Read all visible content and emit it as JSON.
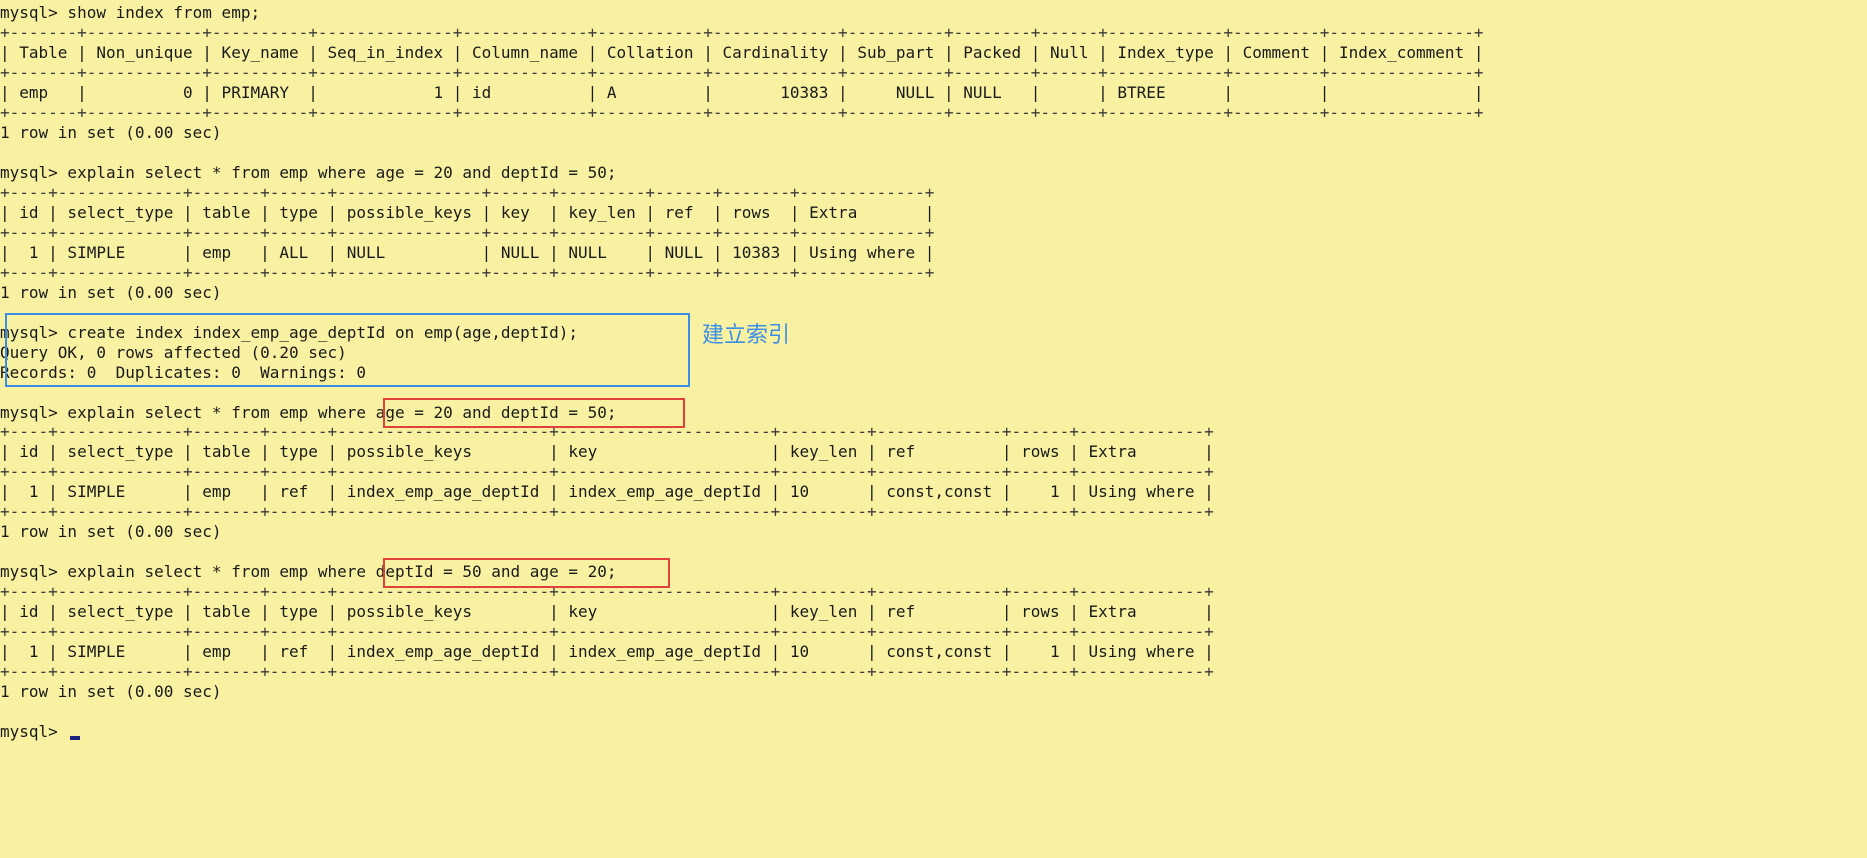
{
  "colors": {
    "background": "#f8f1a2",
    "text": "#1a1a1a",
    "highlight_blue": "#3a8ee6",
    "highlight_red": "#e0413a",
    "annotation_blue": "#3a8ee6",
    "cursor": "#1a237e"
  },
  "lines": [
    "mysql> show index from emp;",
    "+-------+------------+----------+--------------+-------------+-----------+-------------+----------+--------+------+------------+---------+---------------+",
    "| Table | Non_unique | Key_name | Seq_in_index | Column_name | Collation | Cardinality | Sub_part | Packed | Null | Index_type | Comment | Index_comment |",
    "+-------+------------+----------+--------------+-------------+-----------+-------------+----------+--------+------+------------+---------+---------------+",
    "| emp   |          0 | PRIMARY  |            1 | id          | A         |       10383 |     NULL | NULL   |      | BTREE      |         |               |",
    "+-------+------------+----------+--------------+-------------+-----------+-------------+----------+--------+------+------------+---------+---------------+",
    "1 row in set (0.00 sec)",
    "",
    "mysql> explain select * from emp where age = 20 and deptId = 50;",
    "+----+-------------+-------+------+---------------+------+---------+------+-------+-------------+",
    "| id | select_type | table | type | possible_keys | key  | key_len | ref  | rows  | Extra       |",
    "+----+-------------+-------+------+---------------+------+---------+------+-------+-------------+",
    "|  1 | SIMPLE      | emp   | ALL  | NULL          | NULL | NULL    | NULL | 10383 | Using where |",
    "+----+-------------+-------+------+---------------+------+---------+------+-------+-------------+",
    "1 row in set (0.00 sec)",
    "",
    "mysql> create index index_emp_age_deptId on emp(age,deptId);",
    "Query OK, 0 rows affected (0.20 sec)",
    "Records: 0  Duplicates: 0  Warnings: 0",
    "",
    "mysql> explain select * from emp where age = 20 and deptId = 50;",
    "+----+-------------+-------+------+----------------------+----------------------+---------+-------------+------+-------------+",
    "| id | select_type | table | type | possible_keys        | key                  | key_len | ref         | rows | Extra       |",
    "+----+-------------+-------+------+----------------------+----------------------+---------+-------------+------+-------------+",
    "|  1 | SIMPLE      | emp   | ref  | index_emp_age_deptId | index_emp_age_deptId | 10      | const,const |    1 | Using where |",
    "+----+-------------+-------+------+----------------------+----------------------+---------+-------------+------+-------------+",
    "1 row in set (0.00 sec)",
    "",
    "mysql> explain select * from emp where deptId = 50 and age = 20;",
    "+----+-------------+-------+------+----------------------+----------------------+---------+-------------+------+-------------+",
    "| id | select_type | table | type | possible_keys        | key                  | key_len | ref         | rows | Extra       |",
    "+----+-------------+-------+------+----------------------+----------------------+---------+-------------+------+-------------+",
    "|  1 | SIMPLE      | emp   | ref  | index_emp_age_deptId | index_emp_age_deptId | 10      | const,const |    1 | Using where |",
    "+----+-------------+-------+------+----------------------+----------------------+---------+-------------+------+-------------+",
    "1 row in set (0.00 sec)",
    "",
    "mysql> "
  ],
  "annotation": {
    "text": "建立索引"
  }
}
